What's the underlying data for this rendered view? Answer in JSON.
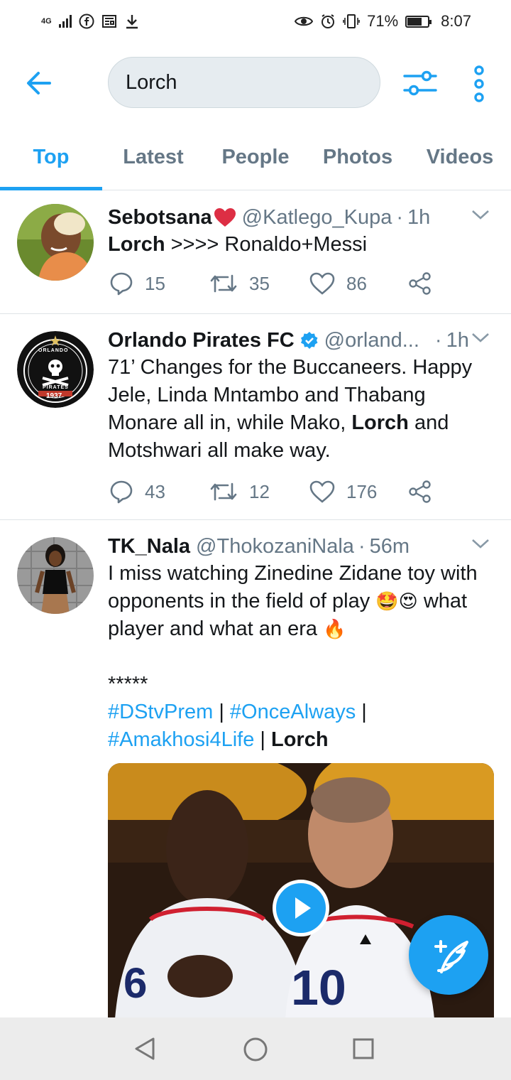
{
  "status_bar": {
    "network": "4G",
    "battery": "71%",
    "battery_level": 0.71,
    "time": "8:07"
  },
  "search": {
    "query": "Lorch"
  },
  "tabs": [
    {
      "label": "Top",
      "active": true
    },
    {
      "label": "Latest",
      "active": false
    },
    {
      "label": "People",
      "active": false
    },
    {
      "label": "Photos",
      "active": false
    },
    {
      "label": "Videos",
      "active": false
    }
  ],
  "tweets": [
    {
      "name": "Sebotsana",
      "handle": "@Katlego_Kupa",
      "time": "1h",
      "text_bold": "Lorch",
      "text_rest": " >>>> Ronaldo+Messi",
      "replies": "15",
      "retweets": "35",
      "likes": "86"
    },
    {
      "name": "Orlando Pirates FC",
      "handle": "@orland...",
      "time": "1h",
      "text_before": "71’ Changes for the Buccaneers. Happy Jele, Linda Mntambo and Thabang Monare all in, while Mako, ",
      "text_bold": "Lorch",
      "text_after": " and Motshwari all make way.",
      "replies": "43",
      "retweets": "12",
      "likes": "176",
      "avatar_text_top": "ORLANDO",
      "avatar_text_bottom": "PIRATES",
      "avatar_year": "1937"
    },
    {
      "name": "TK_Nala",
      "handle": "@ThokozaniNala",
      "time": "56m",
      "line1": "I miss watching Zinedine Zidane toy with opponents in the field of play",
      "emoji1": "🤩😍",
      "line1b": " what player and what an era ",
      "emoji2": "🔥",
      "stars": "*****",
      "hashtag1": "#DStvPrem",
      "sep1": " | ",
      "hashtag2": "#OnceAlways",
      "sep2": " |",
      "hashtag3": "#Amakhosi4Life",
      "sep3": " | ",
      "text_bold": "Lorch",
      "jersey_number": "10",
      "jersey_number_left": "6"
    }
  ],
  "colors": {
    "accent": "#1da1f2",
    "muted": "#657786",
    "heart": "#e0245e"
  }
}
